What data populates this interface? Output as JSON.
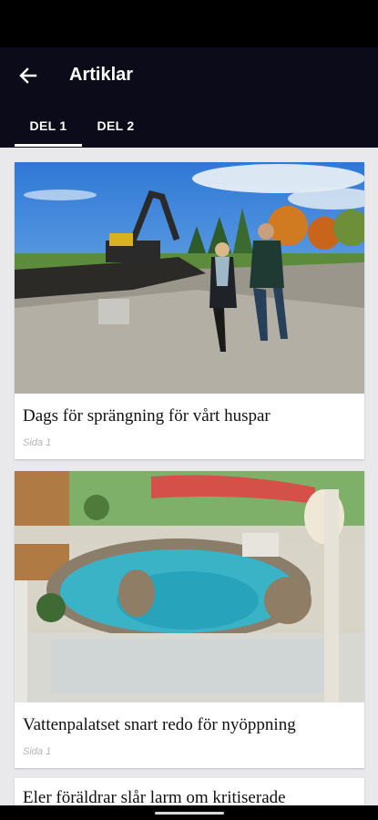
{
  "header": {
    "title": "Artiklar",
    "back_icon": "arrow-left-icon"
  },
  "tabs": [
    {
      "label": "DEL 1",
      "selected": true
    },
    {
      "label": "DEL 2",
      "selected": false
    }
  ],
  "articles": [
    {
      "headline": "Dags för sprängning för vårt huspar",
      "page": "Sida 1",
      "image": "two people walking on a construction site with an excavator"
    },
    {
      "headline": "Vattenpalatset snart redo för nyöppning",
      "page": "Sida 1",
      "image": "indoor water park pool with red water slide"
    },
    {
      "headline": "Eler föräldrar slår larm om kritiserade"
    }
  ],
  "colors": {
    "app_bar": "#0b0b1a",
    "status_bar": "#000000",
    "background": "#e9e9eb",
    "card": "#ffffff",
    "headline_text": "#111111",
    "page_label_text": "#b5b5b5"
  }
}
